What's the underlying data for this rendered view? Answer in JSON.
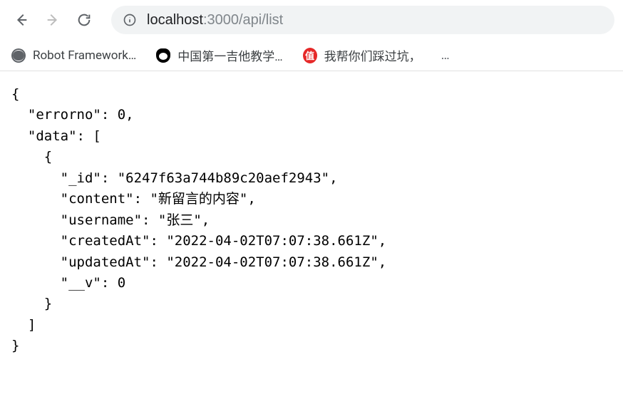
{
  "toolbar": {
    "url_host": "localhost",
    "url_rest": ":3000/api/list"
  },
  "bookmarks": [
    {
      "label": "Robot Framework…",
      "icon": "globe"
    },
    {
      "label": "中国第一吉他教学…",
      "icon": "penguin"
    },
    {
      "label": "我帮你们踩过坑，",
      "icon": "zhi",
      "badge": "值"
    }
  ],
  "response": {
    "errorno": 0,
    "data": [
      {
        "_id": "6247f63a744b89c20aef2943",
        "content": "新留言的内容",
        "username": "张三",
        "createdAt": "2022-04-02T07:07:38.661Z",
        "updatedAt": "2022-04-02T07:07:38.661Z",
        "__v": 0
      }
    ]
  },
  "ellipsis": "…"
}
